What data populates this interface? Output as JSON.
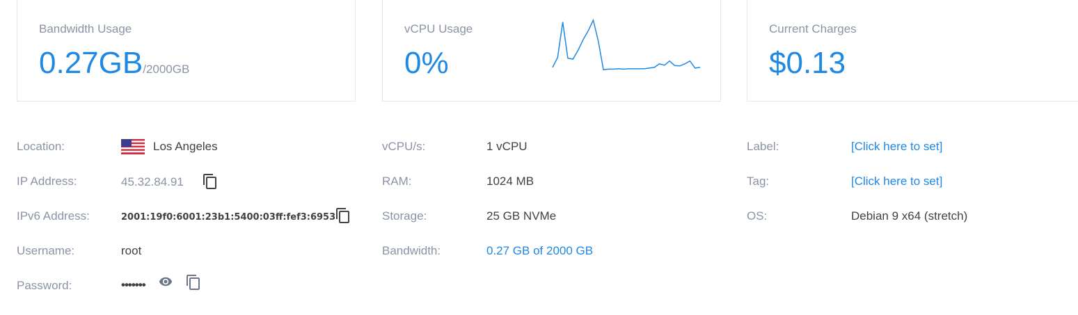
{
  "stats": {
    "bandwidth": {
      "title": "Bandwidth Usage",
      "value": "0.27GB",
      "unit": "/2000GB"
    },
    "vcpu": {
      "title": "vCPU Usage",
      "value": "0%",
      "sparkline": [
        12,
        40,
        140,
        38,
        35,
        60,
        90,
        115,
        145,
        85,
        5,
        7,
        7,
        8,
        7,
        8,
        8,
        8,
        8,
        10,
        12,
        22,
        18,
        30,
        17,
        16,
        22,
        30,
        10,
        12
      ]
    },
    "charges": {
      "title": "Current Charges",
      "value": "$0.13"
    }
  },
  "details": {
    "col1": {
      "location_label": "Location:",
      "location_value": "Los Angeles",
      "location_flag": "us-flag-icon",
      "ip_label": "IP Address:",
      "ip_value": "45.32.84.91",
      "ipv6_label": "IPv6 Address:",
      "ipv6_value": "2001:19f0:6001:23b1:5400:03ff:fef3:6953",
      "username_label": "Username:",
      "username_value": "root",
      "password_label": "Password:",
      "password_value": "•••••••"
    },
    "col2": {
      "vcpus_label": "vCPU/s:",
      "vcpus_value": "1 vCPU",
      "ram_label": "RAM:",
      "ram_value": "1024 MB",
      "storage_label": "Storage:",
      "storage_value": "25 GB NVMe",
      "bandwidth_label": "Bandwidth:",
      "bandwidth_value": "0.27 GB of 2000 GB"
    },
    "col3": {
      "label_label": "Label:",
      "label_value": "[Click here to set]",
      "tag_label": "Tag:",
      "tag_value": "[Click here to set]",
      "os_label": "OS:",
      "os_value": "Debian 9 x64 (stretch)"
    }
  },
  "colors": {
    "accent": "#1e88e5",
    "muted": "#8a93a6",
    "border": "#e3e5ea"
  },
  "icons": [
    "us-flag-icon",
    "copy-icon",
    "eye-icon"
  ]
}
